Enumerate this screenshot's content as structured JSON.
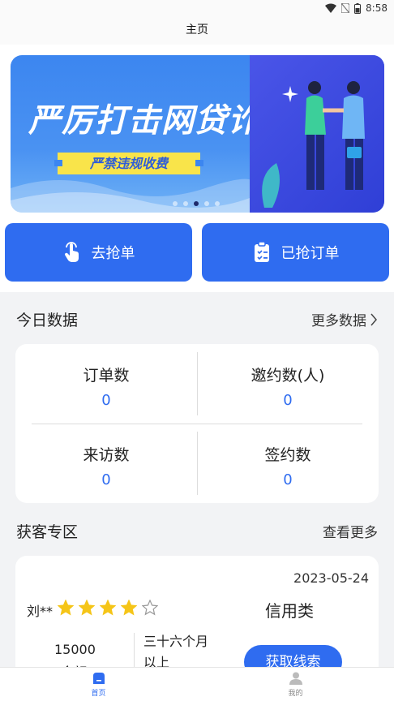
{
  "status_bar": {
    "time": "8:58"
  },
  "header": {
    "title": "主页"
  },
  "banner": {
    "title": "严厉打击网贷诈骗",
    "tag": "严禁违规收费",
    "dot_count": 5,
    "active_dot": 2
  },
  "actions": {
    "grab_label": "去抢单",
    "grabbed_label": "已抢订单"
  },
  "today": {
    "title": "今日数据",
    "more_label": "更多数据",
    "stats": [
      {
        "label": "订单数",
        "value": "0"
      },
      {
        "label": "邀约数(人)",
        "value": "0"
      },
      {
        "label": "来访数",
        "value": "0"
      },
      {
        "label": "签约数",
        "value": "0"
      }
    ]
  },
  "customers": {
    "title": "获客专区",
    "more_label": "查看更多",
    "card": {
      "date": "2023-05-24",
      "name": "刘**",
      "rating": 4,
      "max_rating": 5,
      "category": "信用类",
      "amount": "15000",
      "amount_label": "金额",
      "term": "三十六个月以上",
      "button_label": "获取线索"
    }
  },
  "tabbar": {
    "home_label": "首页",
    "mine_label": "我的"
  },
  "colors": {
    "primary": "#2f6cf0",
    "star": "#f5c518",
    "banner_tag": "#f9e44a"
  }
}
